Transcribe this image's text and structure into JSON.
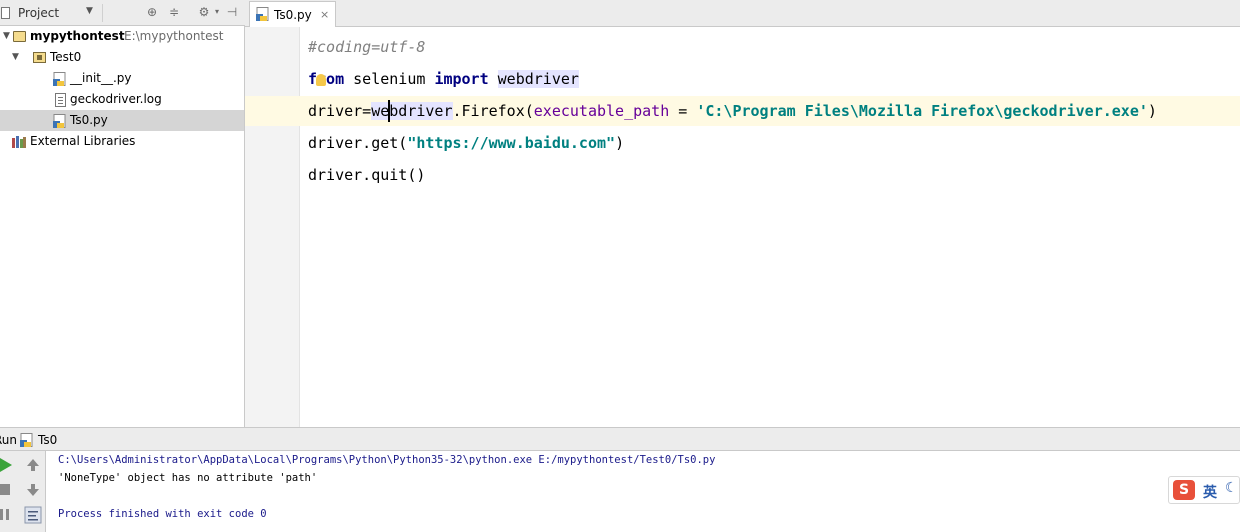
{
  "project_panel": {
    "title": "Project",
    "tree": [
      {
        "label": "mypythontest",
        "path": "E:\\mypythontest"
      },
      {
        "label": "Test0"
      },
      {
        "label": "__init__.py"
      },
      {
        "label": "geckodriver.log"
      },
      {
        "label": "Ts0.py"
      },
      {
        "label": "External Libraries"
      }
    ]
  },
  "editor": {
    "tab_label": "Ts0.py",
    "lines": {
      "l1": "#coding=utf-8",
      "l2_kw1": "from",
      "l2_mid": " selenium ",
      "l2_kw2": "import",
      "l2_sp": " ",
      "l2_mod": "webdriver",
      "l3_a": "driver=",
      "l3_mod": "webdriver",
      "l3_b": ".Firefox(",
      "l3_param": "executable_path",
      "l3_eq": " = ",
      "l3_str": "'C:\\Program Files\\Mozilla Firefox\\geckodriver.exe'",
      "l3_end": ")",
      "l4_a": "driver.get(",
      "l4_str": "\"https://www.baidu.com\"",
      "l4_end": ")",
      "l5": "driver.quit()"
    }
  },
  "run_panel": {
    "title_prefix": "Run",
    "config_name": "Ts0",
    "console": {
      "command": "C:\\Users\\Administrator\\AppData\\Local\\Programs\\Python\\Python35-32\\python.exe E:/mypythontest/Test0/Ts0.py",
      "error": "'NoneType' object has no attribute 'path'",
      "finished": "Process finished with exit code 0"
    }
  },
  "ime": {
    "label": "英"
  },
  "colors": {
    "keyword": "#000080",
    "string": "#008080",
    "comment": "#808080",
    "param": "#660099",
    "caret_line": "#fffae3"
  }
}
